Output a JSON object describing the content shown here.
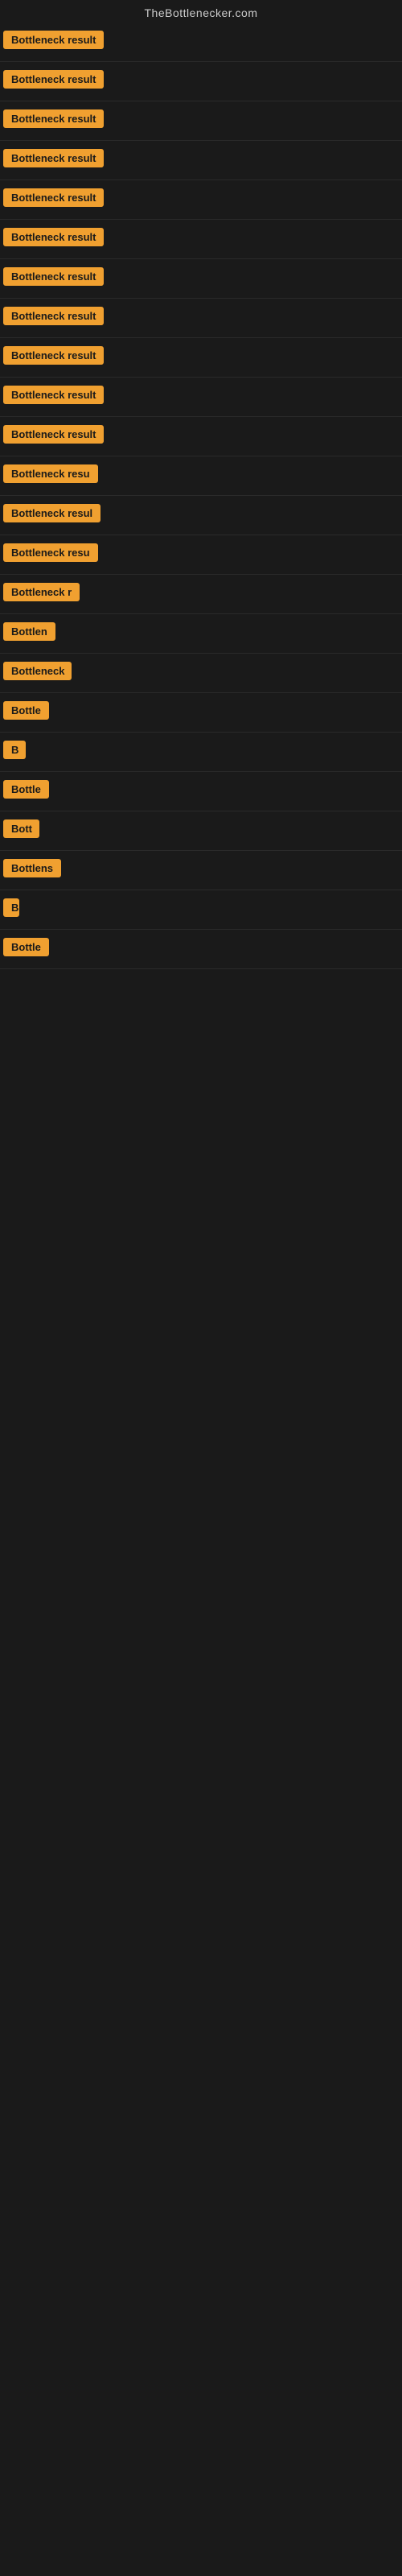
{
  "header": {
    "site_title": "TheBottlenecker.com"
  },
  "rows": [
    {
      "id": 1,
      "label": "Bottleneck result"
    },
    {
      "id": 2,
      "label": "Bottleneck result"
    },
    {
      "id": 3,
      "label": "Bottleneck result"
    },
    {
      "id": 4,
      "label": "Bottleneck result"
    },
    {
      "id": 5,
      "label": "Bottleneck result"
    },
    {
      "id": 6,
      "label": "Bottleneck result"
    },
    {
      "id": 7,
      "label": "Bottleneck result"
    },
    {
      "id": 8,
      "label": "Bottleneck result"
    },
    {
      "id": 9,
      "label": "Bottleneck result"
    },
    {
      "id": 10,
      "label": "Bottleneck result"
    },
    {
      "id": 11,
      "label": "Bottleneck result"
    },
    {
      "id": 12,
      "label": "Bottleneck resu"
    },
    {
      "id": 13,
      "label": "Bottleneck resul"
    },
    {
      "id": 14,
      "label": "Bottleneck resu"
    },
    {
      "id": 15,
      "label": "Bottleneck r"
    },
    {
      "id": 16,
      "label": "Bottlen"
    },
    {
      "id": 17,
      "label": "Bottleneck"
    },
    {
      "id": 18,
      "label": "Bottle"
    },
    {
      "id": 19,
      "label": "B"
    },
    {
      "id": 20,
      "label": "Bottle"
    },
    {
      "id": 21,
      "label": "Bott"
    },
    {
      "id": 22,
      "label": "Bottlens"
    },
    {
      "id": 23,
      "label": "B"
    },
    {
      "id": 24,
      "label": "Bottle"
    }
  ]
}
